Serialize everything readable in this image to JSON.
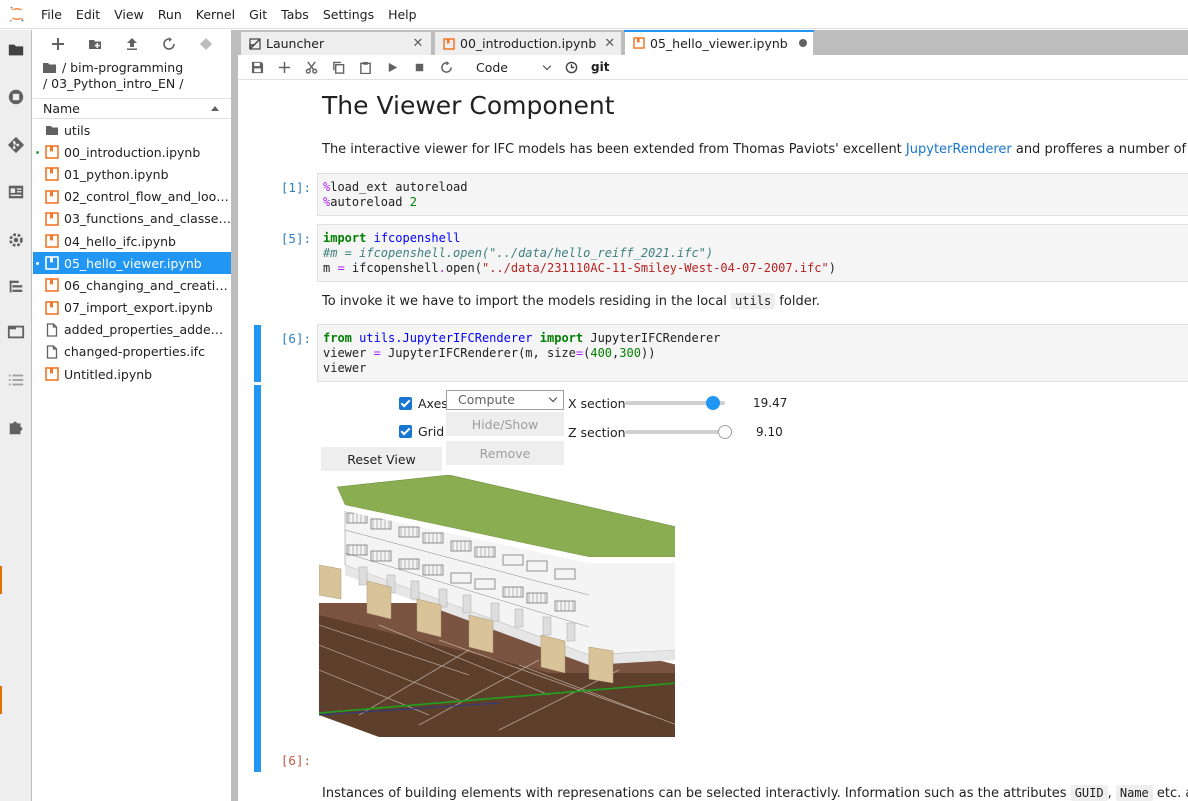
{
  "menubar": {
    "items": [
      "File",
      "Edit",
      "View",
      "Run",
      "Kernel",
      "Git",
      "Tabs",
      "Settings",
      "Help"
    ]
  },
  "filebrowser": {
    "breadcrumb_line1": "/ bim-programming",
    "breadcrumb_line2": "/ 03_Python_intro_EN /",
    "column_header": "Name",
    "files": [
      {
        "name": "utils",
        "type": "folder",
        "running": false,
        "selected": false
      },
      {
        "name": "00_introduction.ipynb",
        "type": "notebook",
        "running": true,
        "selected": false
      },
      {
        "name": "01_python.ipynb",
        "type": "notebook",
        "running": false,
        "selected": false
      },
      {
        "name": "02_control_flow_and_loops.i...",
        "type": "notebook",
        "running": false,
        "selected": false
      },
      {
        "name": "03_functions_and_classes.ip...",
        "type": "notebook",
        "running": false,
        "selected": false
      },
      {
        "name": "04_hello_ifc.ipynb",
        "type": "notebook",
        "running": false,
        "selected": false
      },
      {
        "name": "05_hello_viewer.ipynb",
        "type": "notebook",
        "running": true,
        "selected": true
      },
      {
        "name": "06_changing_and_creating.i...",
        "type": "notebook",
        "running": false,
        "selected": false
      },
      {
        "name": "07_import_export.ipynb",
        "type": "notebook",
        "running": false,
        "selected": false
      },
      {
        "name": "added_properties_added.ifc",
        "type": "file",
        "running": false,
        "selected": false
      },
      {
        "name": "changed-properties.ifc",
        "type": "file",
        "running": false,
        "selected": false
      },
      {
        "name": "Untitled.ipynb",
        "type": "notebook",
        "running": false,
        "selected": false
      }
    ]
  },
  "tabs": [
    {
      "label": "Launcher",
      "icon": "launcher-icon",
      "active": false
    },
    {
      "label": "00_introduction.ipynb",
      "icon": "notebook-icon",
      "active": false
    },
    {
      "label": "05_hello_viewer.ipynb",
      "icon": "notebook-icon",
      "active": true
    }
  ],
  "toolbar": {
    "cell_type": "Code",
    "git_label": "git"
  },
  "notebook": {
    "title": "The Viewer Component",
    "intro_before_link": "The interactive viewer for IFC models has been extended from Thomas Paviots' excellent ",
    "intro_link": "JupyterRenderer",
    "intro_after_link": " and profferes a number of functionalities:",
    "cell1_prompt": "[1]:",
    "cell2_prompt": "[5]:",
    "invoke_text_before": "To invoke it we have to import the models residing in the local ",
    "invoke_code": "utils",
    "invoke_text_after": " folder.",
    "cell3_prompt": "[6]:",
    "output_prompt": "[6]:",
    "bottom_text_before": "Instances of building elements with represenations can be selected interactivly. Information such as the attributes ",
    "bottom_code1": "GUID",
    "bottom_sep": ", ",
    "bottom_code2": "Name",
    "bottom_text_after": " etc. are displayed to"
  },
  "widget": {
    "axes_label": "Axes",
    "grid_label": "Grid",
    "compute_select": "Compute",
    "hide_show_label": "Hide/Show",
    "remove_label": "Remove",
    "reset_view_label": "Reset View",
    "x_section_label": "X section",
    "x_section_value": "19.47",
    "x_section_fraction": 0.88,
    "z_section_label": "Z section",
    "z_section_value": "9.10",
    "z_section_fraction": 1.0
  },
  "colors": {
    "accent": "#2196f3",
    "roof": "#8aad52",
    "ground": "#6b4a36",
    "door": "#d9c49a"
  }
}
